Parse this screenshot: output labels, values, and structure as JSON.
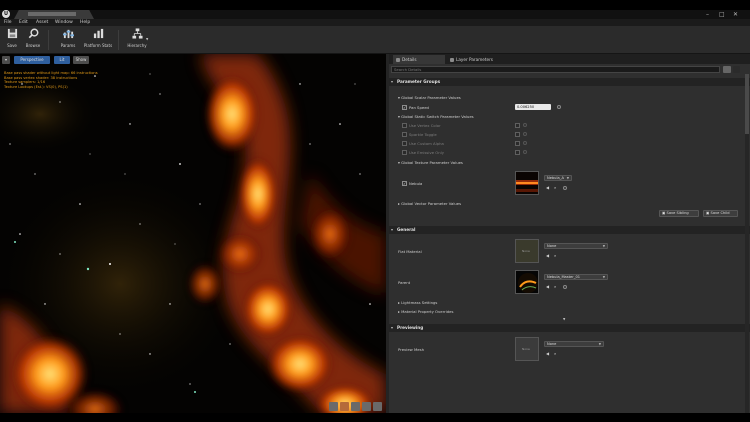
{
  "title_bar": {
    "logo": "U",
    "window_controls": [
      "–",
      "□",
      "✕"
    ]
  },
  "menu": [
    "File",
    "Edit",
    "Asset",
    "Window",
    "Help"
  ],
  "toolbar": [
    {
      "label": "Save",
      "icon": "save-icon"
    },
    {
      "label": "Browse",
      "icon": "browse-icon"
    },
    {
      "label": "Params",
      "icon": "params-icon"
    },
    {
      "label": "Platform Stats",
      "icon": "platform-stats-icon"
    },
    {
      "label": "Hierarchy",
      "icon": "hierarchy-icon"
    }
  ],
  "viewport": {
    "buttons": [
      "▾",
      "Perspective",
      "Lit",
      "Show"
    ],
    "stats": [
      "Base pass shader without light map: 66 instructions",
      "Base pass vertex shader: 38 instructions",
      "Texture samplers: 1/16",
      "Texture Lookups (Est.): VS(0), PS(1)"
    ]
  },
  "details": {
    "tabs": [
      {
        "label": "Details"
      },
      {
        "label": "Layer Parameters"
      }
    ],
    "search_placeholder": "Search Details",
    "sections": {
      "parameter_groups": "Parameter Groups",
      "general": "General",
      "previewing": "Previewing"
    },
    "groups": {
      "scalar": "Global Scalar Parameter Values",
      "static_switch": "Global Static Switch Parameter Values",
      "texture": "Global Texture Parameter Values",
      "vector": "Global Vector Parameter Values"
    },
    "scalar_params": [
      {
        "name": "Pan Speed",
        "value": "0.006250"
      }
    ],
    "switch_params": [
      "Use Vertex Color",
      "Sparkle Toggle",
      "Use Custom Alpha",
      "Use Emissive Only"
    ],
    "texture_params": [
      {
        "name": "Nebula",
        "value": "Nebula_A"
      }
    ],
    "buttons": {
      "save_sibling": "Save Sibling",
      "save_child": "Save Child"
    },
    "general_rows": [
      {
        "name": "Flat Material",
        "value": "None"
      },
      {
        "name": "Parent",
        "value": "Nebula_Master_01"
      }
    ],
    "sub_sections": [
      "Lightmass Settings",
      "Material Property Overrides"
    ],
    "previewing_rows": [
      {
        "name": "Preview Mesh",
        "value": "None"
      }
    ]
  }
}
